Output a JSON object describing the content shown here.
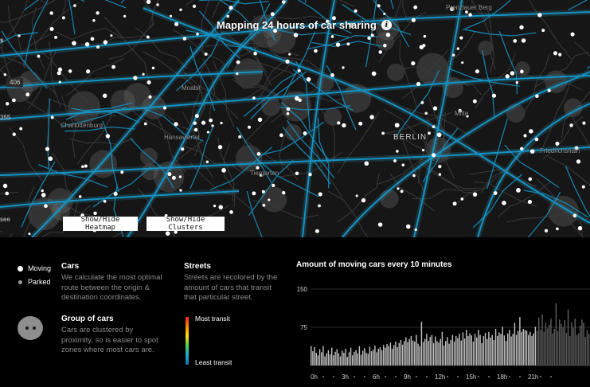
{
  "map": {
    "title": "Mapping 24 hours of car sharing",
    "info_icon": "i",
    "places": [
      {
        "id": "prenzlauer",
        "label": "Prenzlauer Berg"
      },
      {
        "id": "moabit",
        "label": "Moabit"
      },
      {
        "id": "charlottenburg",
        "label": "Charlottenburg"
      },
      {
        "id": "hansaviertel",
        "label": "Hansaviertel"
      },
      {
        "id": "tiergarten",
        "label": "Tiergarten"
      },
      {
        "id": "berlin",
        "label": "BERLIN"
      },
      {
        "id": "mitte",
        "label": "Mitte"
      },
      {
        "id": "friedrichshain",
        "label": "Friedrichshain"
      }
    ],
    "edge_labels": {
      "top": "s",
      "count": "406",
      "second": "355",
      "bottom": "see"
    },
    "buttons": {
      "heatmap": "Show/Hide Heatmap",
      "clusters": "Show/Hide Clusters"
    },
    "colors": {
      "street": "#1593c4",
      "street_glow": "#2ab4d6",
      "background": "#161616",
      "car": "#ffffff"
    }
  },
  "legend": {
    "moving": "Moving",
    "parked": "Parked",
    "cars": {
      "title": "Cars",
      "desc": [
        "We calculate the most optimal",
        "route between the origin &",
        "destination coordinates."
      ]
    },
    "group": {
      "title": "Group of cars",
      "desc": [
        "Cars are clustered by",
        "proximity, so is easier to spot",
        "zones where most cars are."
      ]
    },
    "streets": {
      "title": "Streets",
      "desc": [
        "Streets are recolored by the",
        "amount of cars that transit",
        "that particular street."
      ],
      "most": "Most transit",
      "least": "Least transit"
    }
  },
  "chart_data": {
    "type": "bar",
    "title": "Amount of moving cars every 10 minutes",
    "xlabel": "",
    "ylabel": "",
    "ylim": [
      0,
      150
    ],
    "yticks": [
      75,
      150
    ],
    "x_ticks": [
      "0h",
      "3h",
      "6h",
      "9h",
      "12h",
      "15h",
      "18h",
      "21h"
    ],
    "bar_interval_minutes": 10,
    "current_time_index": 130,
    "colors": {
      "past": "#bdbdbd",
      "future": "#5a5a5a"
    },
    "values": [
      38,
      28,
      36,
      25,
      20,
      32,
      26,
      38,
      18,
      24,
      30,
      22,
      35,
      20,
      27,
      32,
      24,
      18,
      29,
      25,
      33,
      17,
      26,
      35,
      20,
      27,
      30,
      24,
      38,
      21,
      29,
      34,
      25,
      23,
      37,
      28,
      31,
      39,
      26,
      33,
      36,
      30,
      40,
      35,
      42,
      38,
      45,
      33,
      40,
      47,
      36,
      44,
      50,
      41,
      48,
      55,
      46,
      52,
      58,
      49,
      47,
      60,
      43,
      38,
      86,
      46,
      52,
      62,
      48,
      56,
      60,
      44,
      57,
      48,
      45,
      52,
      66,
      39,
      48,
      56,
      43,
      50,
      60,
      47,
      58,
      54,
      62,
      49,
      65,
      53,
      70,
      58,
      63,
      59,
      47,
      62,
      55,
      70,
      60,
      44,
      58,
      64,
      52,
      66,
      55,
      60,
      50,
      72,
      58,
      65,
      62,
      76,
      59,
      48,
      63,
      70,
      57,
      62,
      84,
      60,
      68,
      95,
      66,
      72,
      70,
      68,
      60,
      66,
      58,
      63,
      76,
      68,
      94,
      70,
      100,
      66,
      84,
      73,
      80,
      92,
      63,
      72,
      122,
      68,
      90,
      82,
      75,
      89,
      64,
      110,
      58,
      85,
      74,
      92,
      60,
      63,
      78,
      90,
      84,
      56,
      70,
      62
    ]
  }
}
